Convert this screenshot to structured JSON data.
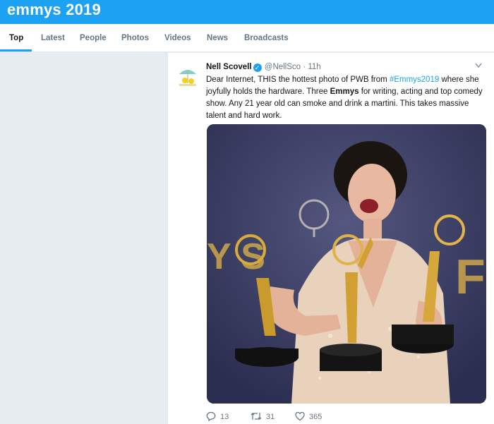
{
  "search": {
    "query": "emmys 2019"
  },
  "tabs": [
    {
      "label": "Top",
      "active": true
    },
    {
      "label": "Latest"
    },
    {
      "label": "People"
    },
    {
      "label": "Photos"
    },
    {
      "label": "Videos"
    },
    {
      "label": "News"
    },
    {
      "label": "Broadcasts"
    }
  ],
  "tweet": {
    "display_name": "Nell Scovell",
    "verified_glyph": "✓",
    "handle": "@NellSco",
    "separator": "·",
    "time": "11h",
    "text": {
      "part1": "Dear Internet, THIS the hottest photo of PWB from ",
      "hashtag": "#Emmys2019",
      "part2": " where she joyfully holds the hardware. Three ",
      "bold_word": "Emmys",
      "part3": " for writing, acting and top comedy show. Any 21 year old can smoke and drink a martini. This takes massive talent and hard work."
    },
    "photo_icon": "photo-woman-holding-three-emmy-awards",
    "actions": {
      "replies": "13",
      "retweets": "31",
      "likes": "365"
    }
  },
  "colors": {
    "brand": "#1da1f2",
    "background": "#e6ecf0",
    "secondary_text": "#657786"
  }
}
